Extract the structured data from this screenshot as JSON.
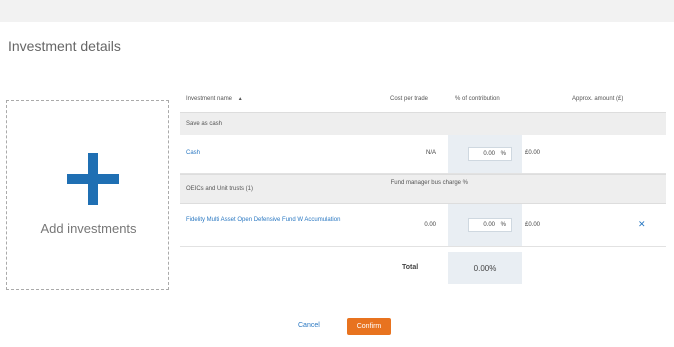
{
  "page": {
    "section_title": "Investment details"
  },
  "add_panel": {
    "label": "Add investments",
    "accent": "#1f6fb3"
  },
  "table": {
    "columns": {
      "investment_name": "Investment name",
      "sort_indicator": "▲",
      "cost_per_trade": "Cost per trade",
      "pct_contribution": "% of contribution",
      "approx_amount": "Approx. amount (£)"
    },
    "groups": [
      {
        "title": "Save as cash",
        "rows": [
          {
            "name": "Cash",
            "cost": "N/A",
            "pct": "0.00",
            "unit": "%",
            "amount": "£0.00",
            "removable": false
          }
        ]
      },
      {
        "title": "OEICs and Unit trusts (1)",
        "charge_header": "Fund manager bus charge %",
        "rows": [
          {
            "name": "Fidelity Multi Asset Open Defensive Fund W Accumulation",
            "cost": "0.00",
            "pct": "0.00",
            "unit": "%",
            "amount": "£0.00",
            "removable": true
          }
        ]
      }
    ],
    "total_label": "Total",
    "total_value": "0.00%"
  },
  "actions": {
    "cancel": "Cancel",
    "confirm": "Confirm",
    "confirm_color": "#e8731f"
  }
}
